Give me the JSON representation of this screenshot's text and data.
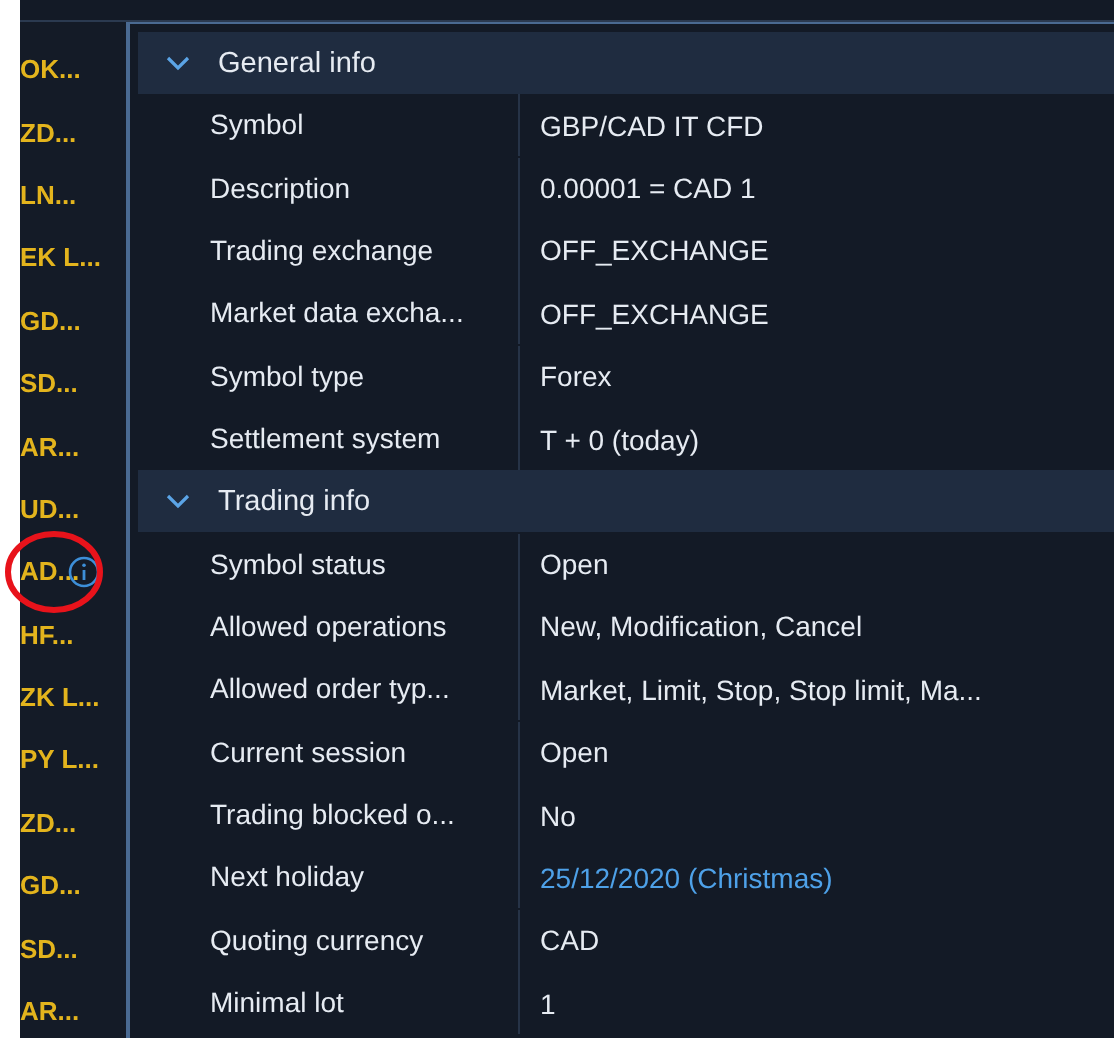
{
  "symbol_list": [
    {
      "label": "OK...",
      "info_icon": false
    },
    {
      "label": "ZD...",
      "info_icon": false
    },
    {
      "label": "LN...",
      "info_icon": false
    },
    {
      "label": "EK L...",
      "info_icon": false
    },
    {
      "label": "GD...",
      "info_icon": false
    },
    {
      "label": "SD...",
      "info_icon": false
    },
    {
      "label": "AR...",
      "info_icon": false
    },
    {
      "label": "UD...",
      "info_icon": false
    },
    {
      "label": "AD...",
      "info_icon": true,
      "highlighted": true
    },
    {
      "label": "HF...",
      "info_icon": false
    },
    {
      "label": "ZK L...",
      "info_icon": false
    },
    {
      "label": "PY L...",
      "info_icon": false
    },
    {
      "label": "ZD...",
      "info_icon": false
    },
    {
      "label": "GD...",
      "info_icon": false
    },
    {
      "label": "SD...",
      "info_icon": false
    },
    {
      "label": "AR...",
      "info_icon": false
    }
  ],
  "sections": [
    {
      "title": "General info",
      "expanded": true,
      "rows": [
        {
          "label": "Symbol",
          "value": "GBP/CAD IT CFD",
          "kind": "text"
        },
        {
          "label": "Description",
          "value": "0.00001 = CAD 1",
          "kind": "text"
        },
        {
          "label": "Trading exchange",
          "value": "OFF_EXCHANGE",
          "kind": "text"
        },
        {
          "label": "Market data excha...",
          "value": "OFF_EXCHANGE",
          "kind": "text"
        },
        {
          "label": "Symbol type",
          "value": "Forex",
          "kind": "text"
        },
        {
          "label": "Settlement system",
          "value": "T + 0 (today)",
          "kind": "text"
        }
      ]
    },
    {
      "title": "Trading info",
      "expanded": true,
      "rows": [
        {
          "label": "Symbol status",
          "value": "Open",
          "kind": "text"
        },
        {
          "label": "Allowed operations",
          "value": "New, Modification, Cancel",
          "kind": "text"
        },
        {
          "label": "Allowed order  typ...",
          "value": "Market, Limit, Stop, Stop limit, Ma...",
          "kind": "text"
        },
        {
          "label": "Current session",
          "value": "Open",
          "kind": "text"
        },
        {
          "label": "Trading blocked o...",
          "value": "No",
          "kind": "text"
        },
        {
          "label": "Next holiday",
          "value": "25/12/2020 (Christmas)",
          "kind": "link"
        },
        {
          "label": "Quoting currency",
          "value": "CAD",
          "kind": "text"
        },
        {
          "label": "Minimal lot",
          "value": "1",
          "kind": "text"
        }
      ]
    }
  ]
}
